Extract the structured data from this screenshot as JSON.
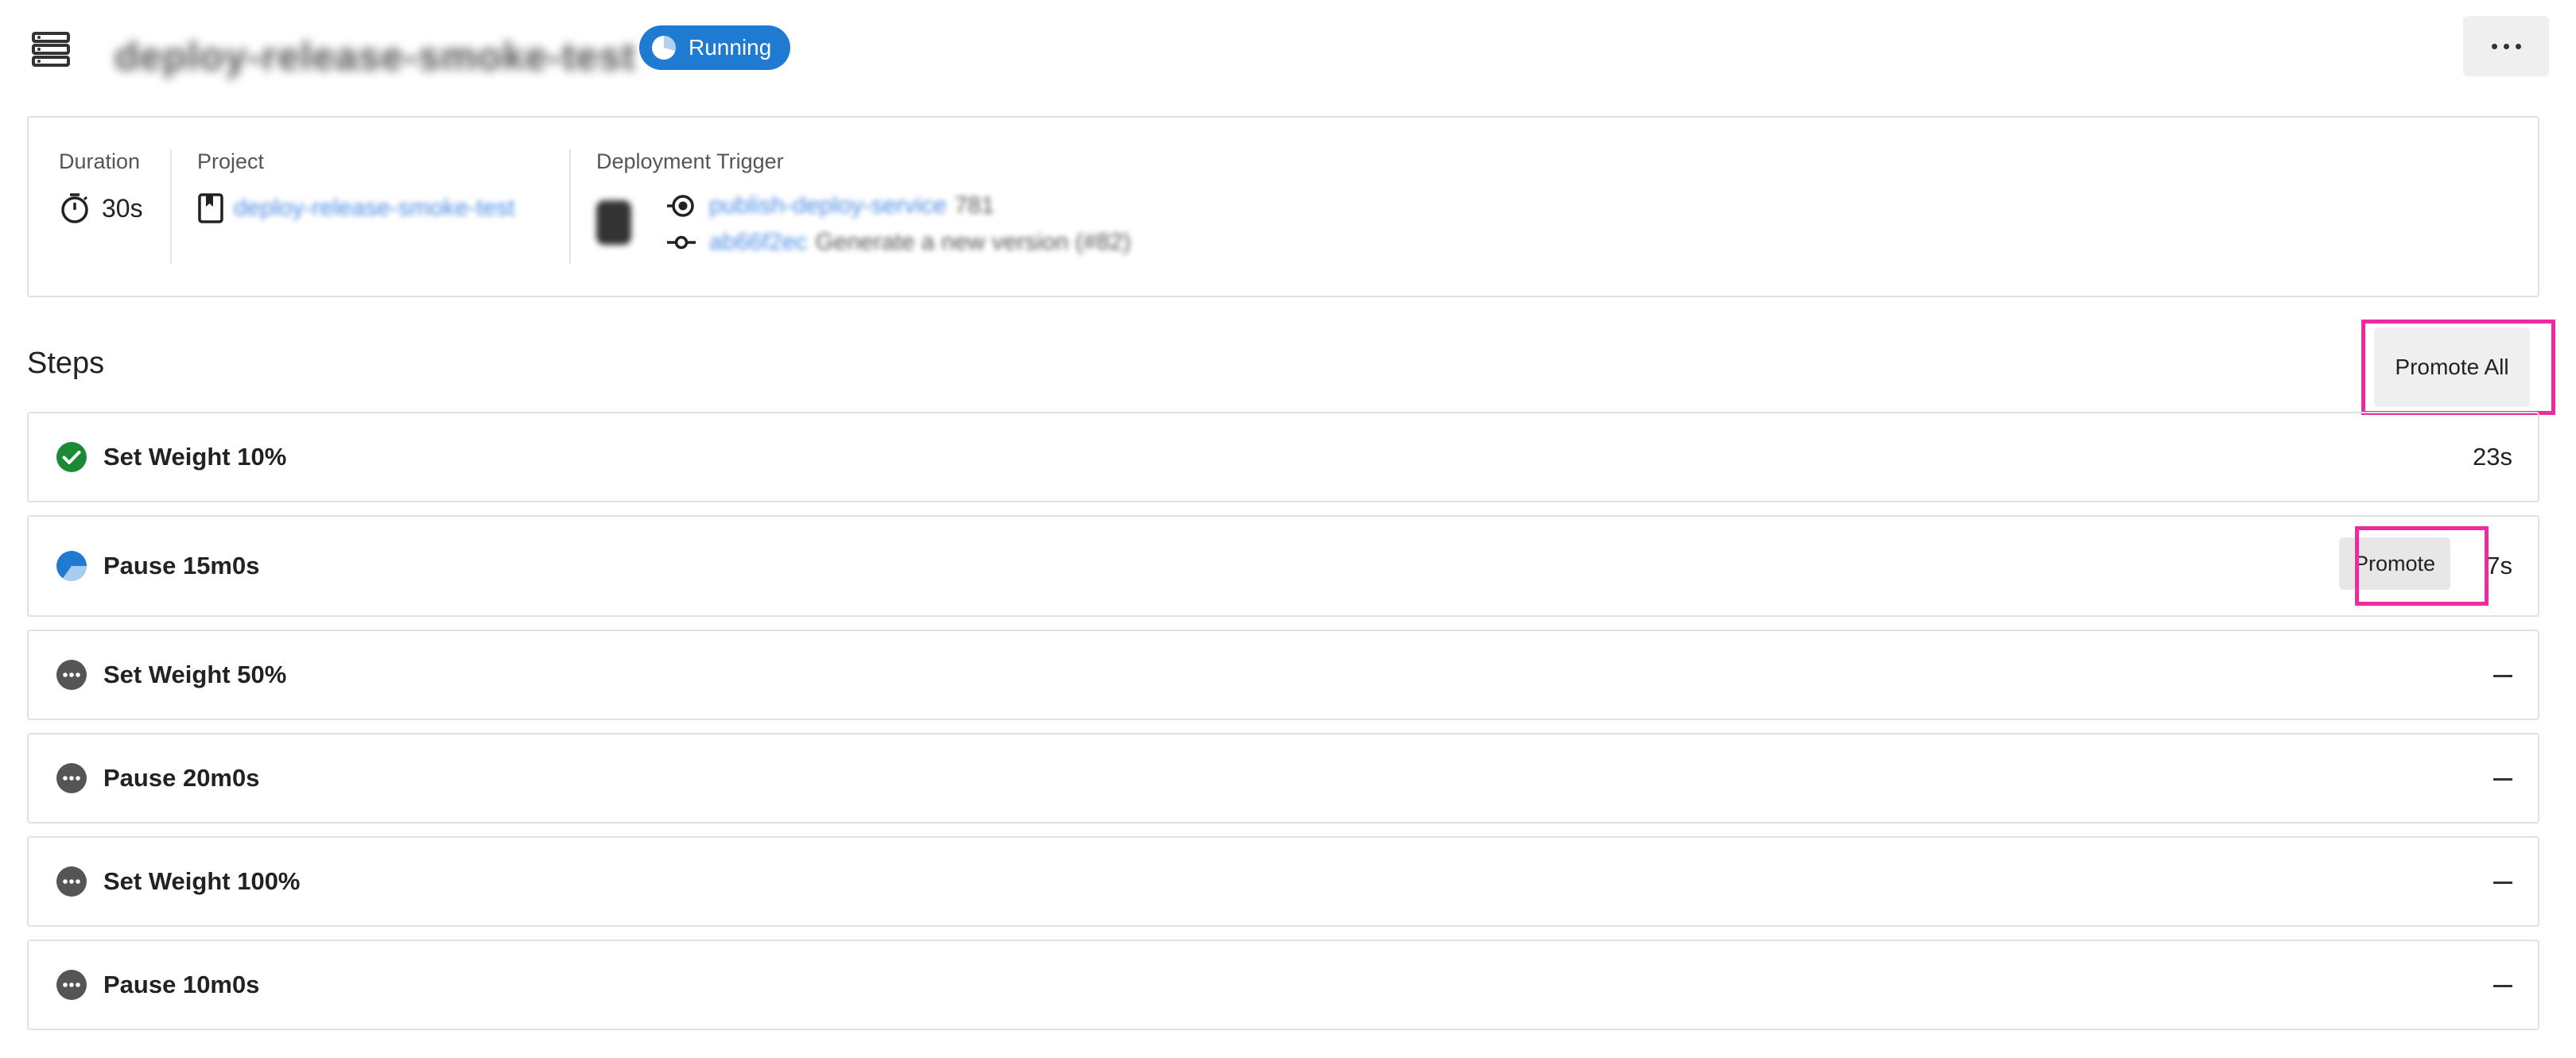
{
  "header": {
    "menu_icon": "list-icon",
    "run_name": "deploy-release-smoke-test",
    "status_label": "Running",
    "status_color": "#1f7ad1",
    "more_icon": "more-horizontal-icon"
  },
  "info": {
    "duration_label": "Duration",
    "duration_value": "30s",
    "project_label": "Project",
    "project_value": "deploy-release-smoke-test",
    "trigger_label": "Deployment Trigger",
    "trigger_service": "publish-deploy-service",
    "trigger_run_number": "781",
    "commit_hash": "ab66f2ec",
    "commit_message": "Generate a new version (#82)"
  },
  "steps_section": {
    "title": "Steps",
    "promote_all_label": "Promote All",
    "promote_label": "Promote",
    "highlight_color": "#ee2a9e"
  },
  "steps": [
    {
      "name": "Set Weight 10%",
      "status": "succeeded",
      "duration": "23s"
    },
    {
      "name": "Pause 15m0s",
      "status": "running",
      "duration": "7s"
    },
    {
      "name": "Set Weight 50%",
      "status": "pending",
      "duration": ""
    },
    {
      "name": "Pause 20m0s",
      "status": "pending",
      "duration": ""
    },
    {
      "name": "Set Weight 100%",
      "status": "pending",
      "duration": ""
    },
    {
      "name": "Pause 10m0s",
      "status": "pending",
      "duration": ""
    }
  ],
  "colors": {
    "success": "#1a8a35",
    "running": "#1f7ad1",
    "pending": "#555555"
  }
}
